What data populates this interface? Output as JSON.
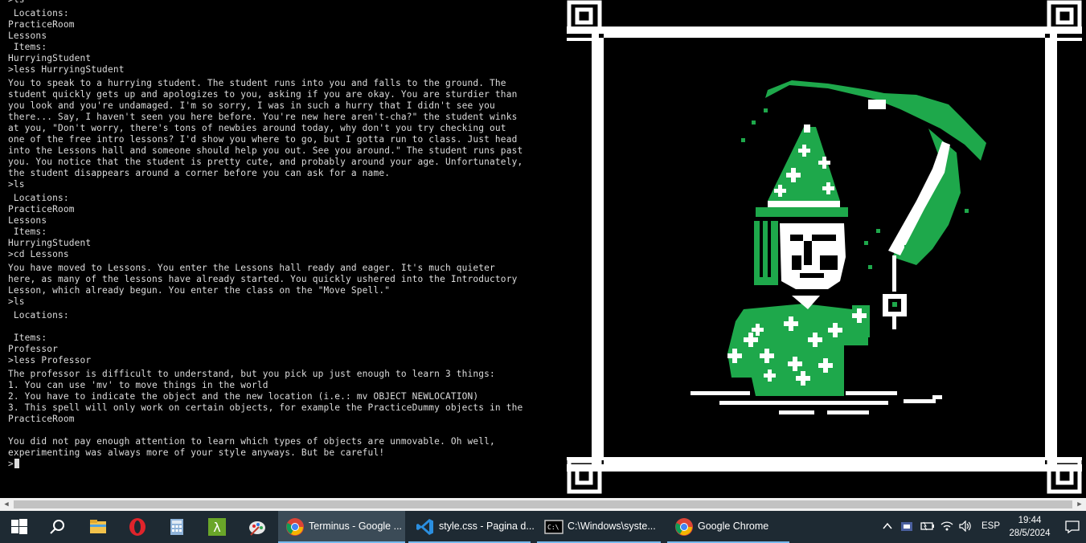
{
  "terminal": {
    "lines": [
      ">ls",
      " Locations:",
      "PracticeRoom",
      "Lessons",
      " Items:",
      "HurryingStudent",
      ">less HurryingStudent",
      "You to speak to a hurrying student. The student runs into you and falls to the ground. The",
      "student quickly gets up and apologizes to you, asking if you are okay. You are sturdier than",
      "you look and you're undamaged. I'm so sorry, I was in such a hurry that I didn't see you",
      "there... Say, I haven't seen you here before. You're new here aren't-cha?\" the student winks",
      "at you, \"Don't worry, there's tons of newbies around today, why don't you try checking out",
      "one of the free intro lessons? I'd show you where to go, but I gotta run to class. Just head",
      "into the Lessons hall and someone should help you out. See you around.\" The student runs past",
      "you. You notice that the student is pretty cute, and probably around your age. Unfortunately,",
      "the student disappears around a corner before you can ask for a name.",
      ">ls",
      " Locations:",
      "PracticeRoom",
      "Lessons",
      " Items:",
      "HurryingStudent",
      ">cd Lessons",
      "You have moved to Lessons. You enter the Lessons hall ready and eager. It's much quieter",
      "here, as many of the lessons have already started. You quickly ushered into the Introductory",
      "Lesson, which already begun. You enter the class on the \"Move Spell.\"",
      ">ls",
      " Locations:",
      "",
      " Items:",
      "Professor",
      ">less Professor",
      "The professor is difficult to understand, but you pick up just enough to learn 3 things:",
      "1. You can use 'mv' to move things in the world",
      "2. You have to indicate the object and the new location (i.e.: mv OBJECT NEWLOCATION)",
      "3. This spell will only work on certain objects, for example the PracticeDummy objects in the",
      "PracticeRoom",
      "",
      "You did not pay enough attention to learn which types of objects are unmovable. Oh well,",
      "experimenting was always more of your style anyways. But be careful!"
    ],
    "prompt": ">"
  },
  "taskbar": {
    "start_icon": "windows-start-icon",
    "search_icon": "search-icon",
    "pinned": [
      "file-explorer-icon",
      "opera-icon",
      "calculator-icon",
      "lambda-app-icon",
      "paint-app-icon"
    ],
    "tasks": [
      {
        "label": "Terminus - Google ...",
        "icon": "chrome-icon"
      },
      {
        "label": "style.css - Pagina d...",
        "icon": "vscode-icon"
      },
      {
        "label": "C:\\Windows\\syste...",
        "icon": "cmd-icon"
      },
      {
        "label": "Google Chrome",
        "icon": "chrome-icon"
      }
    ],
    "tray": {
      "language": "ESP",
      "time": "19:44",
      "date": "28/5/2024",
      "icons": [
        "chevron-up-icon",
        "app-tray-icon",
        "battery-icon",
        "wifi-icon",
        "volume-icon",
        "notification-icon"
      ]
    }
  },
  "colors": {
    "terminal_bg": "#000000",
    "terminal_text": "#dcdcdc",
    "wizard_green": "#1ea84b",
    "taskbar_bg": "#1e2a33",
    "task_underline": "#76b9ed"
  }
}
